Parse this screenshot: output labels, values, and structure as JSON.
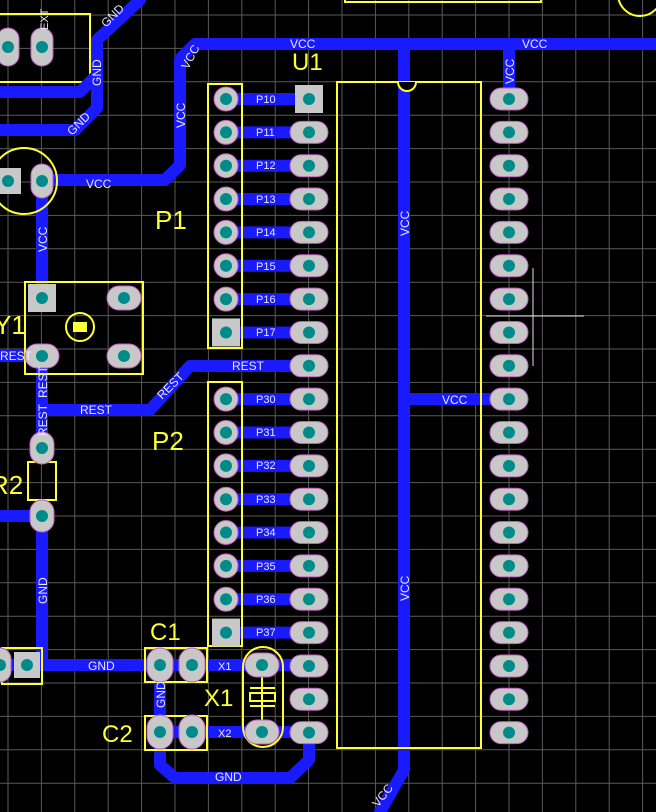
{
  "board": {
    "components": {
      "u1": "U1",
      "p1": "P1",
      "p2": "P2",
      "y1": "Y1",
      "r2": "R2",
      "c1": "C1",
      "c2": "C2",
      "x1": "X1"
    },
    "net_labels": {
      "vcc": "VCC",
      "gnd": "GND",
      "rest": "REST",
      "x1": "X1",
      "x2": "X2",
      "ext": "EXT"
    },
    "p1_pins": [
      "P10",
      "P11",
      "P12",
      "P13",
      "P14",
      "P15",
      "P16",
      "P17"
    ],
    "p2_pins": [
      "P30",
      "P31",
      "P32",
      "P33",
      "P34",
      "P35",
      "P36",
      "P37"
    ],
    "colors": {
      "background": "#000000",
      "grid": "#5a5a5a",
      "trace": "#1a1aff",
      "silkscreen": "#ffff33",
      "pad": "#c8c8c8",
      "via_hole": "#008b8b",
      "net_text": "#e8e8ff"
    }
  }
}
